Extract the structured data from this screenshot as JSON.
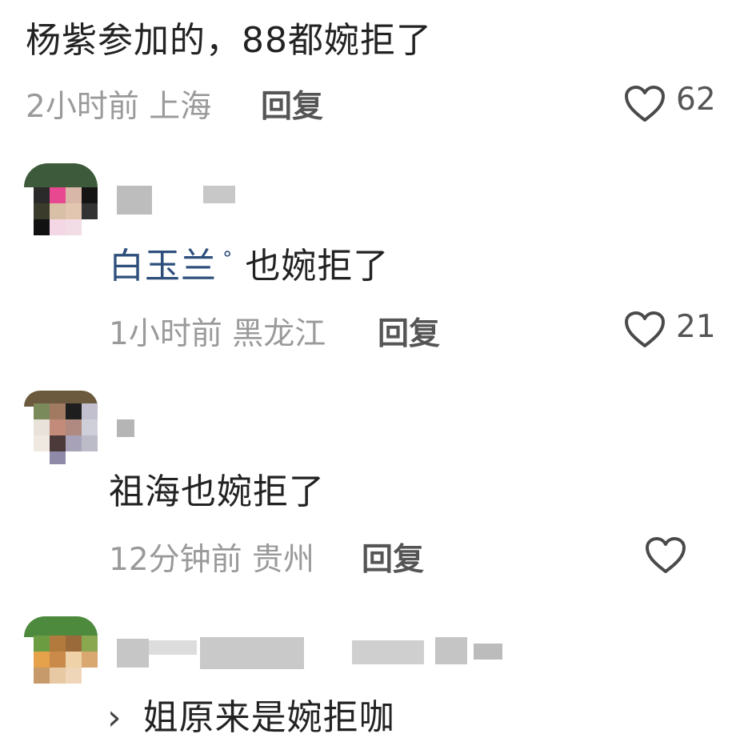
{
  "top_comment": {
    "text": "杨紫参加的，88都婉拒了",
    "meta": "2小时前 上海",
    "reply_label": "回复",
    "likes": "62"
  },
  "replies": [
    {
      "mention": "白玉兰",
      "text": "也婉拒了",
      "meta": "1小时前 黑龙江",
      "reply_label": "回复",
      "likes": "21"
    },
    {
      "text": "祖海也婉拒了",
      "meta": "12分钟前 贵州",
      "reply_label": "回复",
      "likes": ""
    },
    {
      "prefix": "›",
      "text": "姐原来是婉拒咖"
    }
  ],
  "icons": [
    "heart-icon",
    "mention-icon"
  ],
  "colors": {
    "mention": "#2e4f7c",
    "meta": "#9a9a9a"
  }
}
